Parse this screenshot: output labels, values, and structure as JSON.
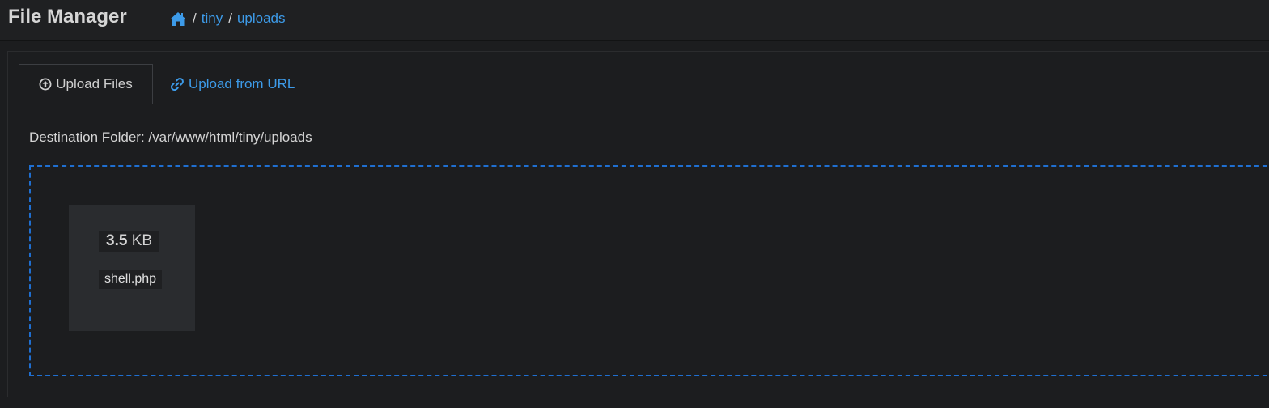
{
  "app": {
    "title": "File Manager"
  },
  "breadcrumb": {
    "home_icon": "home-icon",
    "separator": "/",
    "items": [
      "tiny",
      "uploads"
    ]
  },
  "tabs": [
    {
      "label": "Upload Files",
      "icon": "upload-circle-icon",
      "active": true
    },
    {
      "label": "Upload from URL",
      "icon": "link-icon",
      "active": false
    }
  ],
  "destination": {
    "label": "Destination Folder: /var/www/html/tiny/uploads"
  },
  "dropzone": {
    "files": [
      {
        "size_value": "3.5",
        "size_unit": "KB",
        "name": "shell.php"
      }
    ]
  },
  "colors": {
    "background": "#1c1d1f",
    "navbar": "#1f2022",
    "accent": "#3d9be9",
    "dropzone_border": "#1f6fd1",
    "tile": "#2a2c2f"
  }
}
